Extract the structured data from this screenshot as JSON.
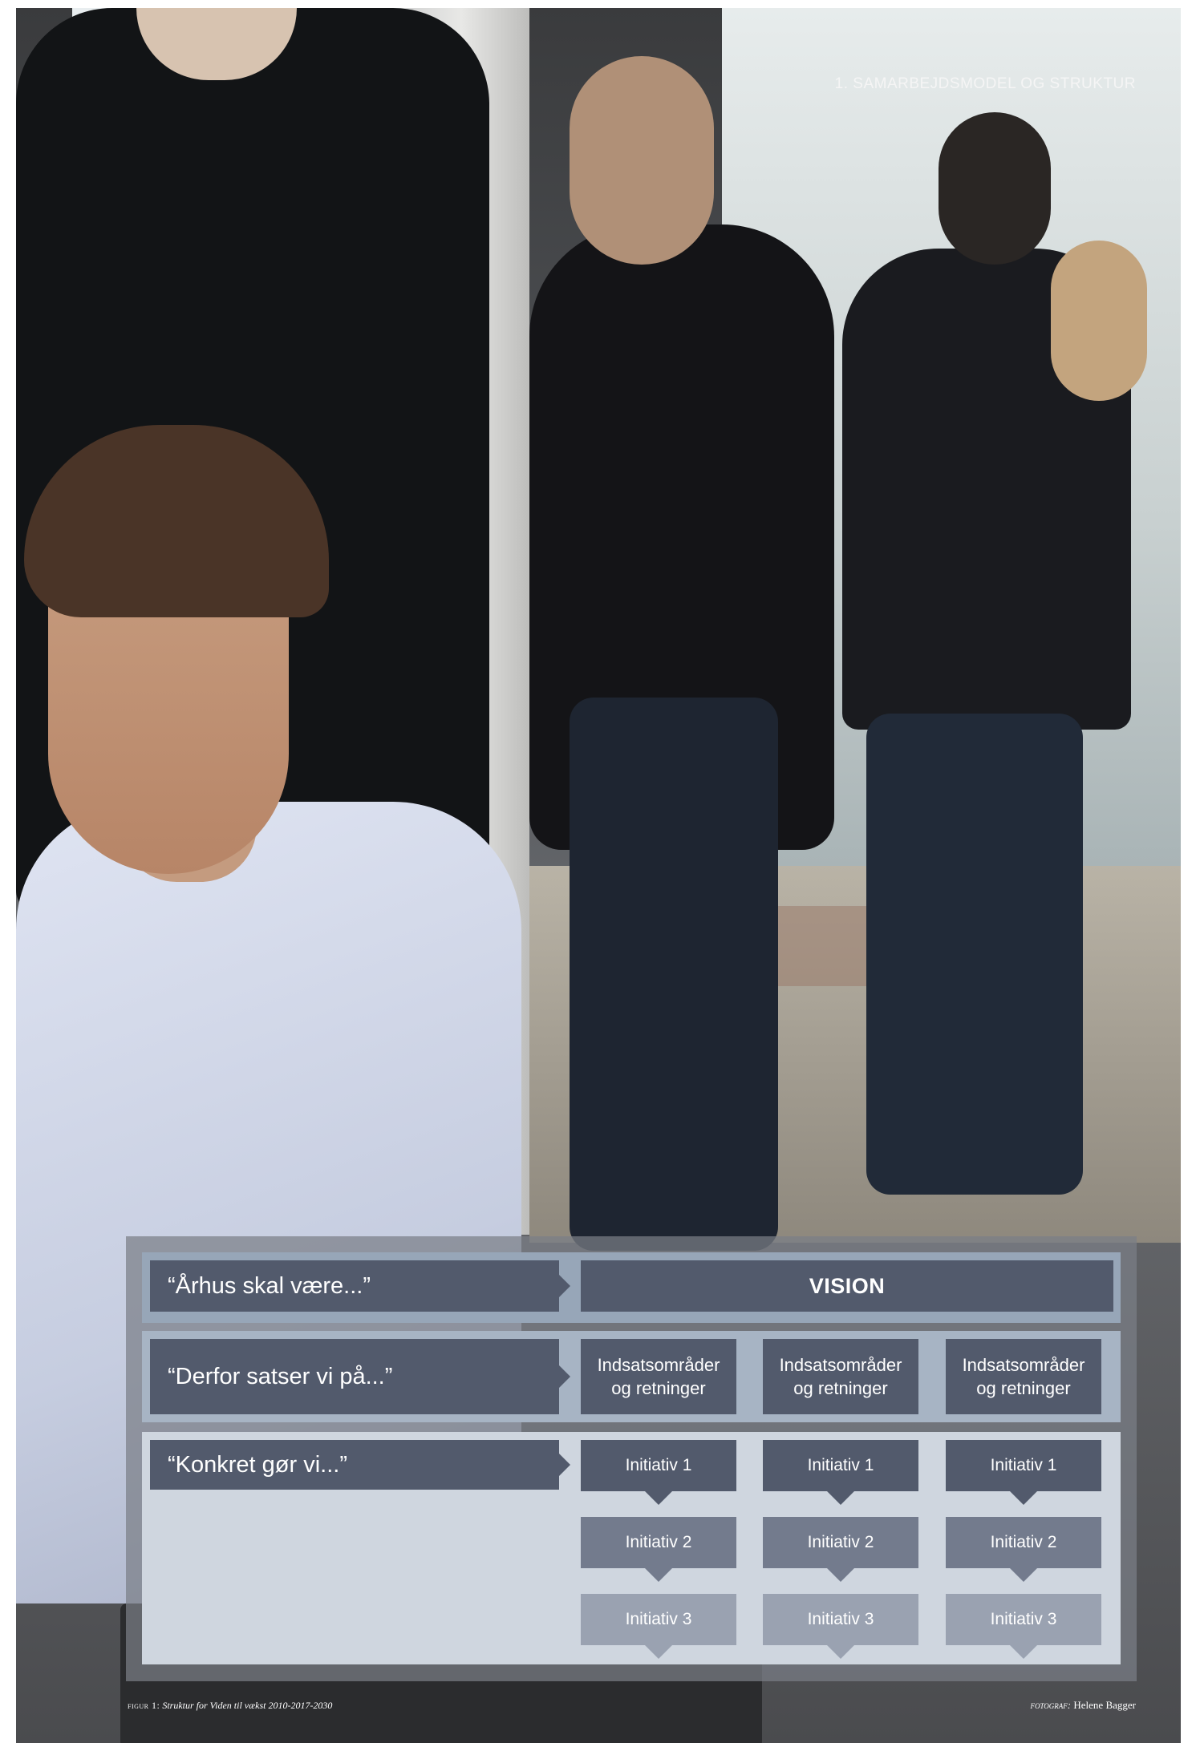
{
  "header": {
    "section_title": "1. SAMARBEJDSMODEL OG STRUKTUR"
  },
  "diagram": {
    "rows": [
      {
        "label": "“Århus skal være...”",
        "content": "VISION"
      },
      {
        "label": "“Derfor satser vi på...”",
        "focus_areas": [
          "Indsatsområder",
          "og retninger"
        ]
      },
      {
        "label": "“Konkret gør vi...”"
      }
    ],
    "initiatives": [
      "Initiativ 1",
      "Initiativ 2",
      "Initiativ 3"
    ]
  },
  "footer": {
    "figure_prefix": "figur 1:",
    "figure_title": "Struktur for Viden til vækst 2010-2017-2030",
    "photo_prefix": "fotograf:",
    "photographer": "Helene Bagger"
  },
  "colors": {
    "box_dark": "#525a6c",
    "box_mid": "#737b8d",
    "box_light": "#9aa2b1",
    "band_top": "#97a6b8"
  }
}
